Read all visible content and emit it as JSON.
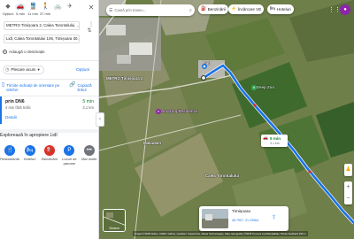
{
  "modes": [
    {
      "icon": "directions-icon",
      "glyph": "◆",
      "label": "Opțiuni"
    },
    {
      "icon": "car-icon",
      "glyph": "🚗",
      "label": "5 min"
    },
    {
      "icon": "transit-icon",
      "glyph": "🚆",
      "label": "11 min"
    },
    {
      "icon": "walk-icon",
      "glyph": "🚶",
      "label": "37 min"
    },
    {
      "icon": "bike-icon",
      "glyph": "🚲",
      "label": ""
    },
    {
      "icon": "flight-icon",
      "glyph": "✈",
      "label": ""
    }
  ],
  "origin": "METRO Timișoara 2, Calea Torontalului, ...",
  "destination": "Lidl, Calea Torontalului 106, Timișoara 30...",
  "add_destination": "Adaugă o destinație",
  "depart_label": "Plecare acum",
  "options_label": "Opțiuni",
  "send_to_phone": "Trimite indicații de orientare pe telefon",
  "copy_link": "Copiază linkul",
  "route": {
    "via": "prin DN6",
    "subtitle": "4 min fără trafic",
    "time": "5 min",
    "distance": "3,1 km",
    "details": "Detalii"
  },
  "explore_title": "Explorează în apropiere Lidl",
  "categories": [
    {
      "icon": "restaurant-icon",
      "glyph": "🍴",
      "color": "#1a73e8",
      "label": "Restaurante"
    },
    {
      "icon": "hotel-icon",
      "glyph": "🛏",
      "color": "#1a73e8",
      "label": "Hoteluri"
    },
    {
      "icon": "gas-station-icon",
      "glyph": "⛽",
      "color": "#d93025",
      "label": "Benzinării"
    },
    {
      "icon": "parking-icon",
      "glyph": "P",
      "color": "#1a73e8",
      "label": "Locuri de parcare"
    },
    {
      "icon": "more-icon",
      "glyph": "•••",
      "color": "#70757a",
      "label": "Mai multe"
    }
  ],
  "map": {
    "search_placeholder": "Caută prin traseu...",
    "chips": {
      "fuel": "Benzinării",
      "ev": "Încărcare VE",
      "hotels": "Hoteluri"
    },
    "places": {
      "metro": "METRO Timișoara 2",
      "amazing": "Amazing Residence",
      "makadam": "Makadam",
      "lidl": "Lidl",
      "calea": "Calea Torontalului",
      "extra": "Deep Zoo"
    },
    "callout_time": "5 min",
    "callout_distance": "3,1 km",
    "attribution": "Imagini ©2025 Airbus, CNES / Airbus, Landsat / Copernicus, Maxar Technologies, Date cartografice ©2025  Termeni  Confidențialitate  Trimite feedback  200 m"
  },
  "streetview": {
    "title": "Timișoara",
    "coords": "45.7907, 21.23064"
  },
  "layers_label": "Straturi",
  "colors": {
    "route": "#1a73e8",
    "accent": "#1a73e8",
    "time_green": "#188038"
  }
}
